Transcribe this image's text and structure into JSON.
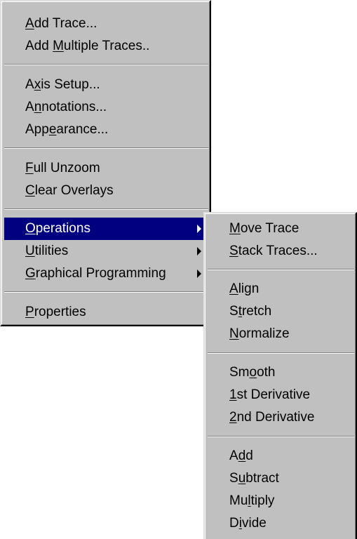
{
  "main_menu": {
    "items": [
      {
        "pre": "",
        "accel": "A",
        "post": "dd Trace..."
      },
      {
        "pre": "Add ",
        "accel": "M",
        "post": "ultiple Traces.."
      },
      {
        "pre": "A",
        "accel": "x",
        "post": "is Setup..."
      },
      {
        "pre": "A",
        "accel": "n",
        "post": "notations..."
      },
      {
        "pre": "App",
        "accel": "e",
        "post": "arance..."
      },
      {
        "pre": "",
        "accel": "F",
        "post": "ull Unzoom"
      },
      {
        "pre": "",
        "accel": "C",
        "post": "lear Overlays"
      },
      {
        "pre": "",
        "accel": "O",
        "post": "perations",
        "state": "highlighted"
      },
      {
        "pre": "",
        "accel": "U",
        "post": "tilities"
      },
      {
        "pre": "",
        "accel": "G",
        "post": "raphical Programming"
      },
      {
        "pre": "",
        "accel": "P",
        "post": "roperties"
      }
    ]
  },
  "sub_menu": {
    "items": [
      {
        "pre": "",
        "accel": "M",
        "post": "ove Trace"
      },
      {
        "pre": "",
        "accel": "S",
        "post": "tack Traces..."
      },
      {
        "pre": "",
        "accel": "A",
        "post": "lign"
      },
      {
        "pre": "S",
        "accel": "t",
        "post": "retch"
      },
      {
        "pre": "",
        "accel": "N",
        "post": "ormalize"
      },
      {
        "pre": "Sm",
        "accel": "o",
        "post": "oth"
      },
      {
        "pre": "",
        "accel": "1",
        "post": "st Derivative"
      },
      {
        "pre": "",
        "accel": "2",
        "post": "nd Derivative"
      },
      {
        "pre": "A",
        "accel": "d",
        "post": "d"
      },
      {
        "pre": "S",
        "accel": "u",
        "post": "btract"
      },
      {
        "pre": "Mu",
        "accel": "l",
        "post": "tiply"
      },
      {
        "pre": "D",
        "accel": "i",
        "post": "vide"
      }
    ]
  }
}
